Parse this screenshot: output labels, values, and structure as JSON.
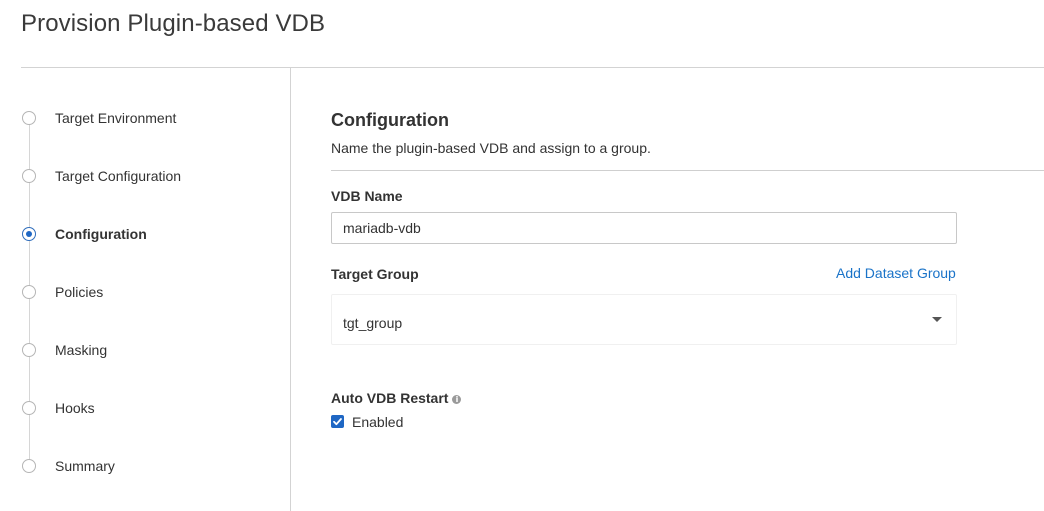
{
  "page": {
    "title": "Provision Plugin-based VDB"
  },
  "sidebar": {
    "steps": [
      {
        "label": "Target Environment",
        "active": false
      },
      {
        "label": "Target Configuration",
        "active": false
      },
      {
        "label": "Configuration",
        "active": true
      },
      {
        "label": "Policies",
        "active": false
      },
      {
        "label": "Masking",
        "active": false
      },
      {
        "label": "Hooks",
        "active": false
      },
      {
        "label": "Summary",
        "active": false
      }
    ]
  },
  "main": {
    "heading": "Configuration",
    "description": "Name the plugin-based VDB and assign to a group.",
    "vdb_name": {
      "label": "VDB Name",
      "value": "mariadb-vdb"
    },
    "target_group": {
      "label": "Target Group",
      "add_link": "Add Dataset Group",
      "selected": "tgt_group"
    },
    "auto_restart": {
      "label": "Auto VDB Restart",
      "checkbox_label": "Enabled",
      "checked": true,
      "info_icon": "info-icon"
    }
  },
  "colors": {
    "accent": "#1f67c4",
    "link": "#1a73c8",
    "divider": "#d3d3d3"
  }
}
